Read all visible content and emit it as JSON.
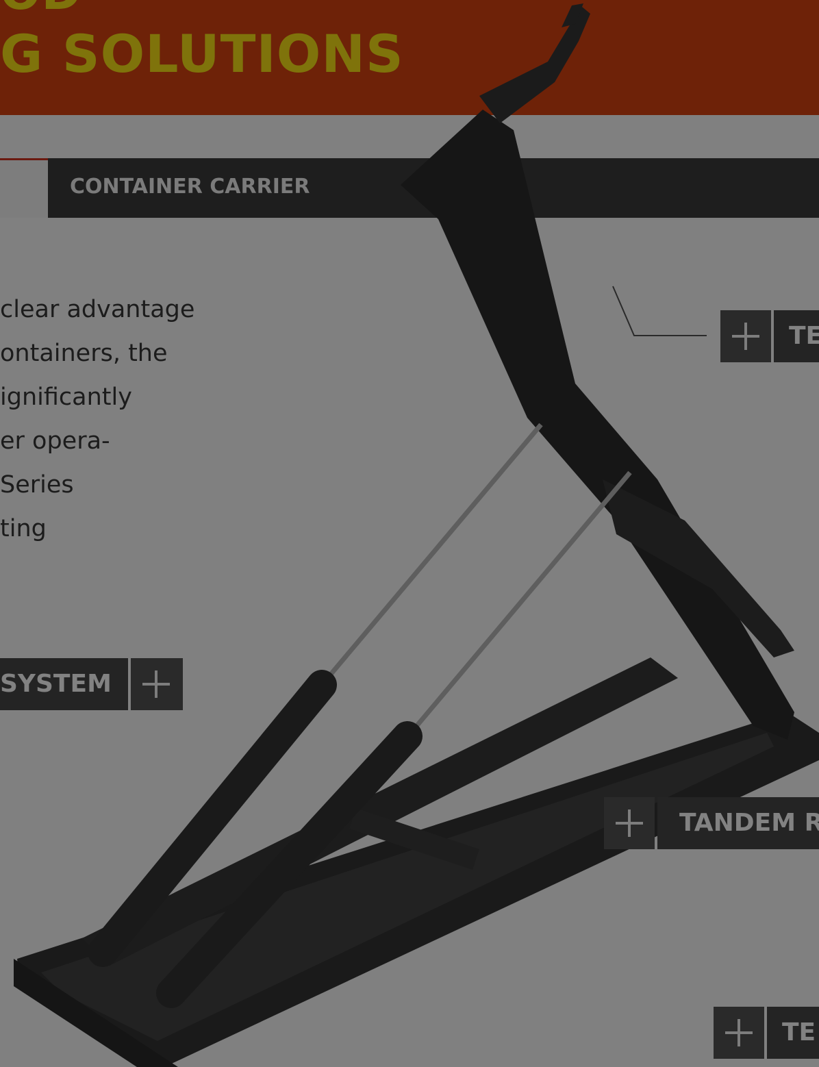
{
  "banner": {
    "line1": "OD",
    "line2": "G SOLUTIONS"
  },
  "tabs": {
    "active_label": "",
    "label": "CONTAINER CARRIER"
  },
  "description": {
    "lines": [
      "clear  advantage",
      "ontainers, the",
      "ignificantly",
      "er opera-",
      "Series",
      "ting"
    ]
  },
  "hotspots": {
    "top_right": "TE",
    "left": "SYSTEM",
    "middle_right": "TANDEM R",
    "bottom_right": "TE"
  },
  "colors": {
    "banner_bg": "#6e2208",
    "banner_text": "#7f730b",
    "page_bg": "#808080",
    "tabbar_bg": "#1e1e1e"
  }
}
